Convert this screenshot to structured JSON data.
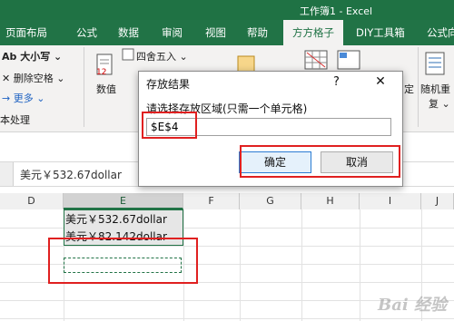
{
  "window": {
    "title": "工作簿1 - Excel"
  },
  "tabs": [
    {
      "label": "页面布局"
    },
    {
      "label": "公式"
    },
    {
      "label": "数据"
    },
    {
      "label": "审阅"
    },
    {
      "label": "视图"
    },
    {
      "label": "帮助"
    },
    {
      "label": "方方格子"
    },
    {
      "label": "DIY工具箱"
    },
    {
      "label": "公式向"
    }
  ],
  "ribbon": {
    "case_btn": "Ab 大小写 ⌄",
    "delete_space_btn": "✕ 删除空格 ⌄",
    "more_btn": "→ 更多 ⌄",
    "group_label": "本处理",
    "number_btn": "数值",
    "round_btn": "四舍五入 ⌄",
    "random_btn": "随机重",
    "random_btn_line2": "复 ⌄",
    "fix_btn": "定"
  },
  "formula_bar": {
    "value": "美元￥532.67dollar"
  },
  "columns": [
    "D",
    "E",
    "F",
    "G",
    "H",
    "I",
    "J"
  ],
  "cells": {
    "e1": "美元￥532.67dollar",
    "e2": "美元￥82.142dollar"
  },
  "dialog": {
    "title": "存放结果",
    "help": "?",
    "close": "✕",
    "prompt": "请选择存放区域(只需一个单元格)",
    "input_value": "$E$4",
    "ok_label": "确定",
    "cancel_label": "取消"
  },
  "watermark": "Bai 经验",
  "colors": {
    "accent": "#217346",
    "annotation": "#e02020"
  }
}
